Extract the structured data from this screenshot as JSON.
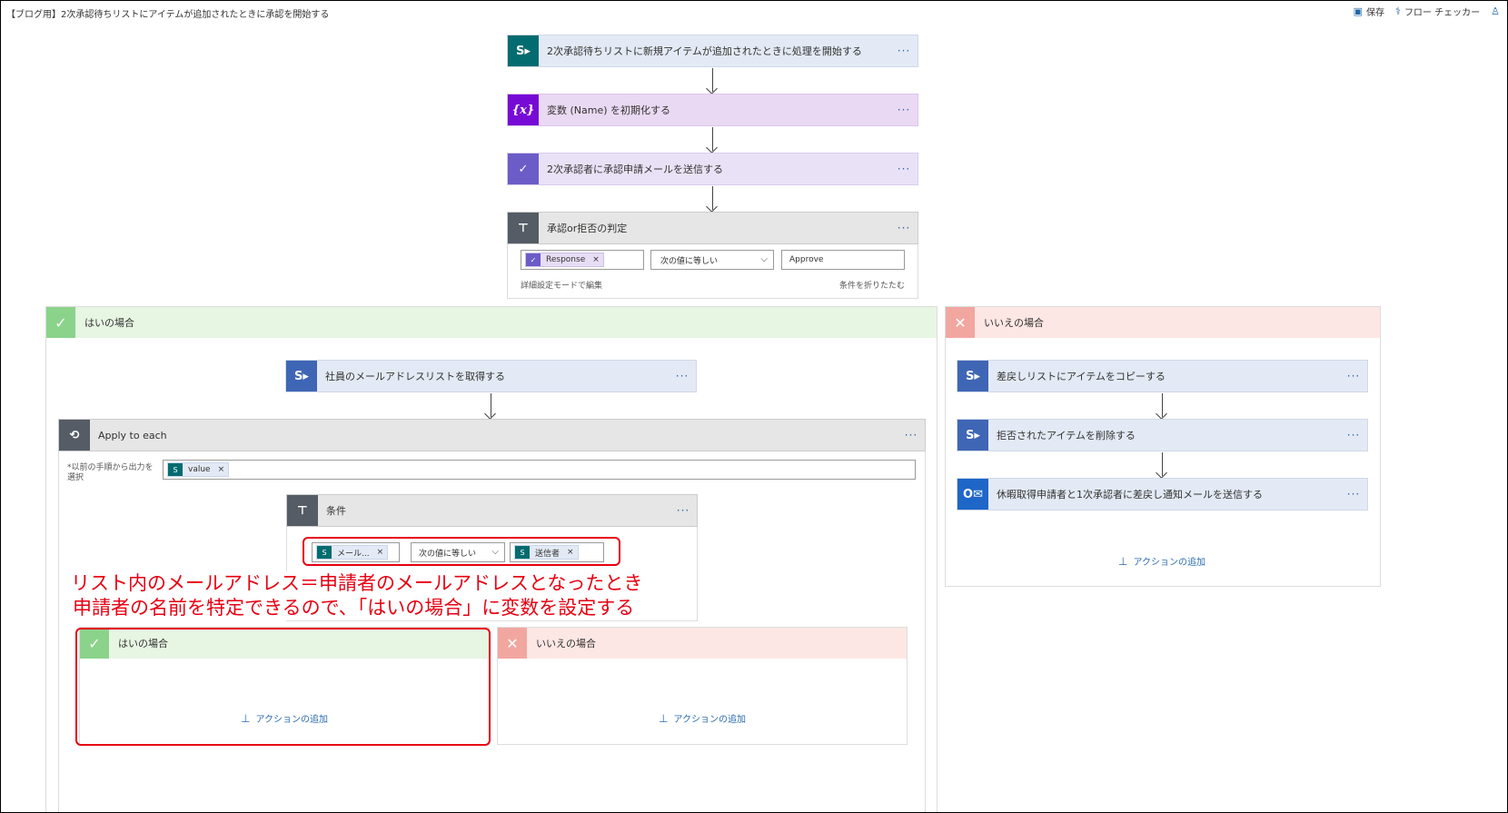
{
  "topbar": {
    "title": "【ブログ用】2次承認待ちリストにアイテムが追加されたときに承認を開始する",
    "save_label": "保存",
    "checker_label": "フロー チェッカー"
  },
  "steps": {
    "trigger": "2次承認待ちリストに新規アイテムが追加されたときに処理を開始する",
    "init_var": "変数 (Name) を初期化する",
    "send_approval": "2次承認者に承認申請メールを送信する",
    "condition_main": "承認or拒否の判定"
  },
  "condition_main": {
    "token_left": "Response",
    "operator": "次の値に等しい",
    "value_right": "Approve",
    "advanced_link": "詳細設定モードで編集",
    "collapse_link": "条件を折りたたむ"
  },
  "yes_branch": {
    "label": "はいの場合",
    "get_emails": "社員のメールアドレスリストを取得する",
    "apply_each": "Apply to each",
    "apply_each_field_label": "*以前の手順から出力を選択",
    "apply_each_token": "value",
    "inner_condition": "条件",
    "inner_token_left": "メール...",
    "inner_operator": "次の値に等しい",
    "inner_token_right": "送信者",
    "inner_yes": "はいの場合",
    "inner_no": "いいえの場合",
    "add_action": "アクションの追加"
  },
  "no_branch": {
    "label": "いいえの場合",
    "copy_item": "差戻しリストにアイテムをコピーする",
    "delete_item": "拒否されたアイテムを削除する",
    "send_mail": "休暇取得申請者と1次承認者に差戻し通知メールを送信する",
    "add_action": "アクションの追加"
  },
  "annotation": {
    "line1": "リスト内のメールアドレス＝申請者のメールアドレスとなったとき",
    "line2": "申請者の名前を特定できるので、「はいの場合」に変数を設定する"
  },
  "icons": {
    "sharepoint": "sharepoint-icon",
    "variable": "variable-icon",
    "approval": "approval-icon",
    "condition": "condition-icon",
    "loop": "loop-icon",
    "outlook": "outlook-icon"
  }
}
